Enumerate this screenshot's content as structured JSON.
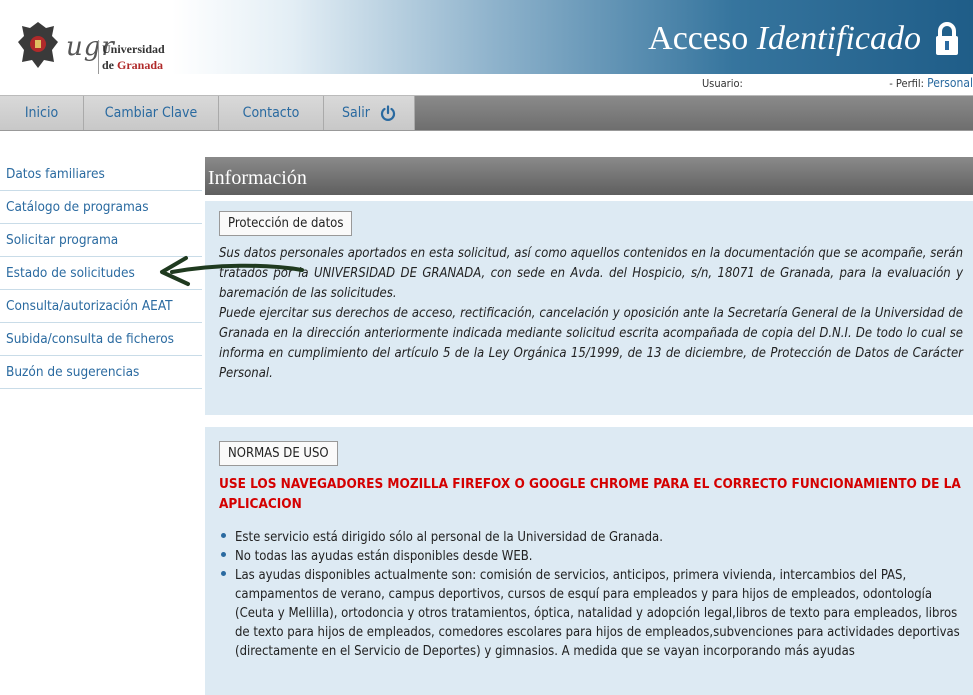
{
  "header": {
    "ugr": "ugr",
    "uni_line1": "Universidad",
    "uni_de": "de",
    "uni_granada": "Granada",
    "title_normal": "Acceso",
    "title_italic": "Identificado",
    "usuario_label": "Usuario:",
    "perfil_label": "- Perfil:",
    "perfil_value": "Personal"
  },
  "nav": {
    "items": [
      "Inicio",
      "Cambiar Clave",
      "Contacto",
      "Salir"
    ]
  },
  "sidebar": {
    "items": [
      "Datos familiares",
      "Catálogo de programas",
      "Solicitar programa",
      "Estado de solicitudes",
      "Consulta/autorización AEAT",
      "Subida/consulta de ficheros",
      "Buzón de sugerencias"
    ]
  },
  "content": {
    "section_title": "Información",
    "privacy_tab": "Protección de datos",
    "privacy_p1": "Sus datos personales aportados en esta solicitud, así como aquellos contenidos en la documentación que se acompañe, serán tratados por la UNIVERSIDAD DE GRANADA, con sede en Avda. del Hospicio, s/n, 18071 de Granada, para la evaluación y baremación de las solicitudes.",
    "privacy_p2": "Puede ejercitar sus derechos de acceso, rectificación, cancelación y oposición ante la Secretaría General de la Universidad de Granada en la dirección anteriormente indicada mediante solicitud escrita acompañada de copia del D.N.I. De todo lo cual se informa en cumplimiento del artículo 5 de la Ley Orgánica 15/1999, de 13 de diciembre, de Protección de Datos de Carácter Personal.",
    "rules_tab": "NORMAS DE USO",
    "warning": "USE LOS NAVEGADORES MOZILLA FIREFOX O GOOGLE CHROME PARA EL CORRECTO FUNCIONAMIENTO DE LA APLICACION",
    "bullets": [
      "Este servicio está dirigido sólo al personal de la Universidad de Granada.",
      "No todas las ayudas están disponibles desde WEB.",
      "Las ayudas disponibles actualmente son: comisión de servicios, anticipos, primera vivienda, intercambios del PAS, campamentos de verano, campus deportivos, cursos de esquí para empleados y para hijos de empleados, odontología (Ceuta y Mellilla), ortodoncia y otros tratamientos, óptica, natalidad y adopción legal,libros de texto para empleados, libros de texto para hijos de empleados, comedores escolares para hijos de empleados,subvenciones para actividades deportivas (directamente en el Servicio de Deportes) y gimnasios. A medida que se vayan incorporando más ayudas"
    ]
  },
  "colors": {
    "link": "#2a6aa0",
    "warning": "#d40000",
    "panel": "#ddeaf3"
  }
}
